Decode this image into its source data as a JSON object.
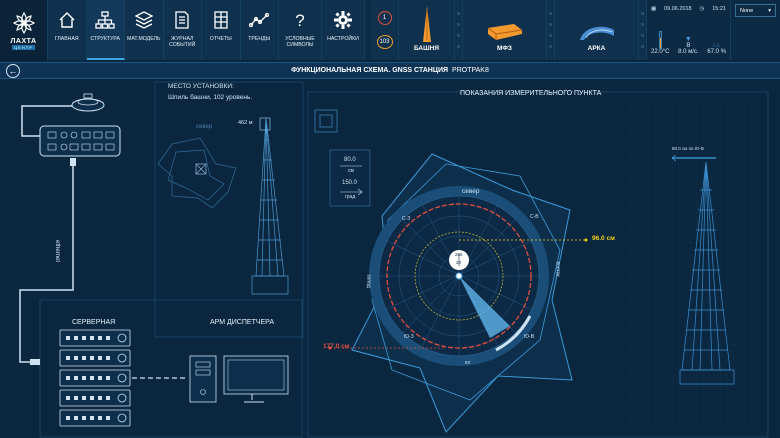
{
  "logo": {
    "name": "ЛАХТА",
    "sub": "ЦЕНТР"
  },
  "nav": [
    {
      "label": "ГЛАВНАЯ",
      "icon": "home-icon"
    },
    {
      "label": "СТРУКТУРА",
      "icon": "structure-icon"
    },
    {
      "label": "МАТ.МОДЕЛЬ",
      "icon": "layers-icon"
    },
    {
      "label": "ЖУРНАЛ СОБЫТИЙ",
      "icon": "journal-icon"
    },
    {
      "label": "ОТЧЕТЫ",
      "icon": "reports-icon"
    },
    {
      "label": "ТРЕНДЫ",
      "icon": "trends-icon"
    },
    {
      "label": "УСЛОВНЫЕ СИМВОЛЫ",
      "icon": "question-icon"
    },
    {
      "label": "НАСТРОЙКИ",
      "icon": "gear-icon"
    }
  ],
  "alarms": {
    "red_count": "1",
    "orange_count": "103"
  },
  "objects": {
    "tower": "БАШНЯ",
    "mfz": "МФЗ",
    "arch": "АРКА"
  },
  "status": {
    "date": "09.06.2018",
    "time": "15:21",
    "temperature": "22.0°C",
    "wind_dir": "В",
    "wind_speed": "8.0 м/с.",
    "humidity": "67.0 %"
  },
  "user": {
    "selected": "None"
  },
  "title": {
    "main": "ФУНКЦИОНАЛЬНАЯ СХЕМА. GNSS СТАНЦИЯ",
    "sub": "PROTPAK8"
  },
  "left": {
    "ethernet": "ethernet",
    "server_label": "СЕРВЕРНАЯ",
    "operator_label": "АРМ ДИСПЕТЧЕРА"
  },
  "location": {
    "heading": "МЕСТО УСТАНОВКИ:",
    "desc": "Шпиль башни, 102 уровень.",
    "height": "462 м",
    "north": "север"
  },
  "readings": {
    "heading": "ПОКАЗАНИЯ ИЗМЕРИТЕЛЬНОГО ПУНКТА",
    "scale_cm_value": "80.0",
    "scale_cm_unit": "см",
    "scale_deg_value": "150.0",
    "scale_deg_unit": "град",
    "north": "север",
    "south": "юг",
    "east": "восток",
    "west": "запад",
    "ne": "С-В",
    "nw": "С-З",
    "sw": "Ю-З",
    "se": "Ю-В",
    "value_right": "96.0 см",
    "value_left": "177.0 см",
    "tower_label": "80.0 см по Ю-В",
    "center_top": "255",
    "center_bottom": "20"
  },
  "colors": {
    "accent": "#3fa3e0",
    "yellow": "#f4d21b",
    "red": "#e0503f",
    "orange": "#f29a2e"
  }
}
